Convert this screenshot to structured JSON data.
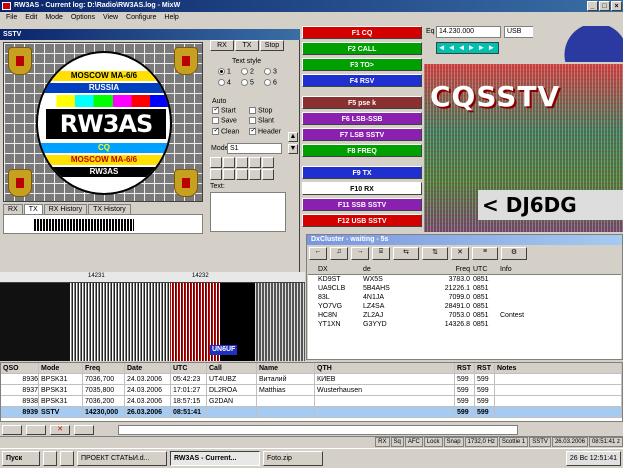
{
  "app": {
    "title": "RW3AS - Current log: D:\\Radio\\RW3AS.log - MixW"
  },
  "menu": [
    "File",
    "Edit",
    "Mode",
    "Options",
    "View",
    "Configure",
    "Help"
  ],
  "sstv": {
    "title": "SSTV",
    "buttons": {
      "rx": "RX",
      "tx": "TX",
      "stop": "Stop"
    },
    "text_style_label": "Text style",
    "styles": [
      "1",
      "2",
      "3",
      "4",
      "5",
      "6"
    ],
    "auto_label": "Auto",
    "checks": [
      {
        "label": "Start",
        "on": true
      },
      {
        "label": "Stop",
        "on": false
      },
      {
        "label": "Save",
        "on": false
      },
      {
        "label": "Slant",
        "on": false
      },
      {
        "label": "Clean",
        "on": true
      },
      {
        "label": "Header",
        "on": true
      }
    ],
    "mode_label": "Mode",
    "mode_value": "S1",
    "text_label": "Text:",
    "tabs": [
      "RX",
      "TX",
      "RX History",
      "TX History"
    ],
    "testcard": {
      "line1": "MOSCOW MA-6/6",
      "line2": "RUSSIA",
      "call": "RW3AS",
      "cq": "CQ",
      "line3": "MOSCOW MA-6/6",
      "line4": "RW3AS"
    }
  },
  "fkeys": [
    {
      "label": "F1        CQ",
      "color": "#d40000"
    },
    {
      "label": "F2      CALL",
      "color": "#00a000"
    },
    {
      "label": "F3       TO>",
      "color": "#00a000"
    },
    {
      "label": "F4       RSV",
      "color": "#2030d0"
    },
    {
      "label": "F5      pse k",
      "color": "#8a3030"
    },
    {
      "label": "F6    LSB-SSB",
      "color": "#8a20b0"
    },
    {
      "label": "F7    LSB SSTV",
      "color": "#8a20b0"
    },
    {
      "label": "F8      FREQ",
      "color": "#00a000"
    },
    {
      "label": "F9        TX",
      "color": "#2030d0"
    },
    {
      "label": "F10       RX",
      "color": "#ffffff"
    },
    {
      "label": "F11   SSB SSTV",
      "color": "#8a20b0"
    },
    {
      "label": "F12   USB SSTV",
      "color": "#d40000"
    }
  ],
  "radio": {
    "freq": "14.230.000",
    "mode": "USB",
    "freq_prefix": "Eq"
  },
  "cq_image": {
    "line1": "CQSSTV",
    "line2": "< DJ6DG"
  },
  "dxcluster": {
    "title": "DxCluster - waiting - 5s",
    "columns": [
      "DX",
      "de",
      "Freq",
      "UTC",
      "Info"
    ],
    "rows": [
      [
        "KD9ST",
        "WX5S",
        "3783.0",
        "0851",
        ""
      ],
      [
        "UA9CLB",
        "5B4AHS",
        "21226.1",
        "0851",
        ""
      ],
      [
        "83L",
        "4N1JA",
        "7099.0",
        "0851",
        ""
      ],
      [
        "YO7VG",
        "LZ4SA",
        "28491.0",
        "0851",
        ""
      ],
      [
        "HC8N",
        "ZL2AJ",
        "7053.0",
        "0851",
        "Contest"
      ],
      [
        "YT1XN",
        "G3YYD",
        "14326.8",
        "0851",
        ""
      ],
      [
        "",
        "",
        "",
        "",
        ""
      ]
    ]
  },
  "waterfall": {
    "marker1": "14231",
    "marker2": "14232",
    "call_tag": "UN6UF"
  },
  "log": {
    "columns": [
      "QSO",
      "Mode",
      "Freq",
      "Date",
      "UTC",
      "Call",
      "Name",
      "QTH",
      "RST",
      "RST",
      "Notes"
    ],
    "rows": [
      [
        "8936",
        "BPSK31",
        "7036,700",
        "24.03.2006",
        "05:42:23",
        "UT4UBZ",
        "Виталий",
        "КИЕВ",
        "599",
        "599",
        ""
      ],
      [
        "8937",
        "BPSK31",
        "7035,800",
        "24.03.2006",
        "17:01:27",
        "DL2ROA",
        "Matthias",
        "Wusterhausen",
        "599",
        "599",
        ""
      ],
      [
        "8938",
        "BPSK31",
        "7036,200",
        "24.03.2006",
        "18:57:15",
        "G2DAN",
        "",
        "",
        "599",
        "599",
        ""
      ],
      [
        "8939",
        "SSTV",
        "14230,000",
        "26.03.2006",
        "08:51:41",
        "",
        "",
        "",
        "599",
        "599",
        ""
      ]
    ]
  },
  "status": [
    "RX",
    "Sq",
    "AFC",
    "Lock",
    "Snap",
    "1732,0 Hz",
    "Scottie 1",
    "SSTV",
    "26.03.2006",
    "08:51:41 z"
  ],
  "taskbar": {
    "start": "Пуск",
    "tasks": [
      "ПРОЕКТ СТАТЬИ.d...",
      "RW3AS - Current...",
      "Foto.zip"
    ],
    "clock": "26 Вс 12:51:41"
  }
}
